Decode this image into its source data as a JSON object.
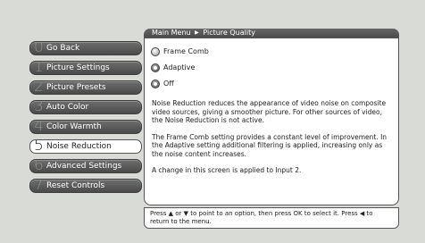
{
  "breadcrumb": {
    "root": "Main Menu",
    "separator": "▶",
    "current": "Picture Quality"
  },
  "menu": {
    "items": [
      {
        "num": "0",
        "label": "Go Back"
      },
      {
        "num": "1",
        "label": "Picture Settings"
      },
      {
        "num": "2",
        "label": "Picture Presets"
      },
      {
        "num": "3",
        "label": "Auto Color"
      },
      {
        "num": "4",
        "label": "Color Warmth"
      },
      {
        "num": "5",
        "label": "Noise Reduction"
      },
      {
        "num": "6",
        "label": "Advanced Settings"
      },
      {
        "num": "7",
        "label": "Reset Controls"
      }
    ],
    "selected_index": 5
  },
  "options": [
    {
      "label": "Frame Comb",
      "selected": true
    },
    {
      "label": "Adaptive",
      "selected": false
    },
    {
      "label": "Off",
      "selected": false
    }
  ],
  "description": {
    "p1": "Noise Reduction reduces the appearance of video noise on composite video sources, giving a smoother picture. For other sources of video, the Noise Reduction is not active.",
    "p2": "The Frame Comb setting provides a constant level of improvement. In the Adaptive setting additional filtering is applied, increasing only as the noise content increases.",
    "p3": "A change in this screen is applied to Input 2."
  },
  "hint": "Press ▲ or ▼ to point to an option, then press OK to select it. Press ◀ to return to the menu."
}
